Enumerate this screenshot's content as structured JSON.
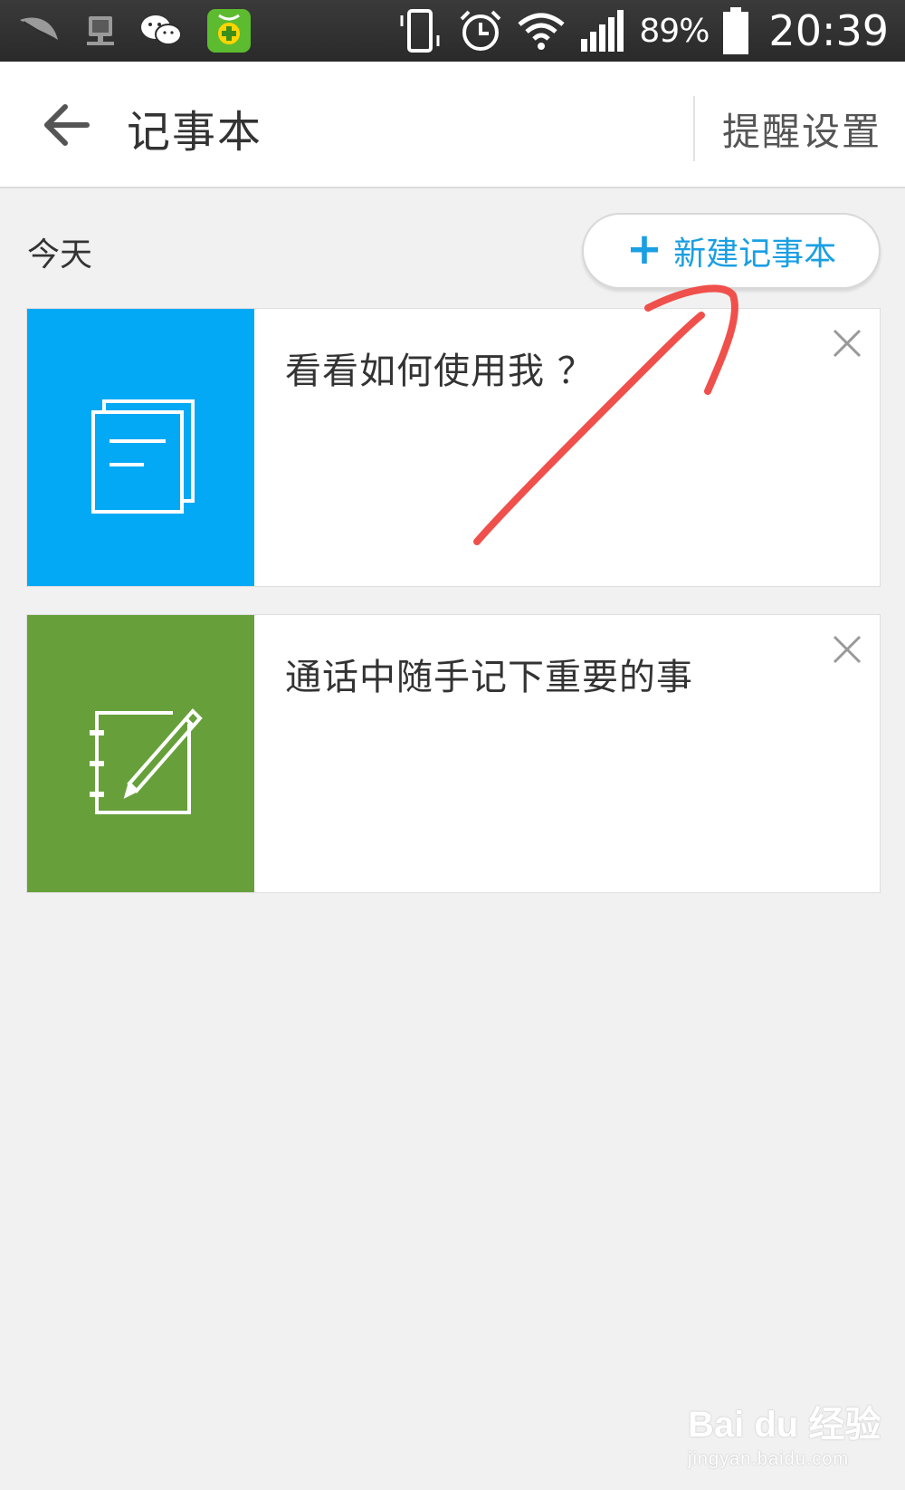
{
  "status_bar": {
    "battery_percent": "89%",
    "time": "20:39",
    "icons": [
      "feather-icon",
      "network-computer-icon",
      "wechat-icon",
      "security-app-icon",
      "vibrate-icon",
      "alarm-icon",
      "wifi-icon",
      "signal-icon",
      "battery-icon"
    ]
  },
  "header": {
    "title": "记事本",
    "back_icon": "arrow-left-icon",
    "remind_settings_label": "提醒设置"
  },
  "section": {
    "label": "今天",
    "new_button_label": "新建记事本"
  },
  "notes": [
    {
      "title": "看看如何使用我 ？",
      "thumb_color": "#03a9f4",
      "icon": "documents-icon"
    },
    {
      "title": "通话中随手记下重要的事",
      "thumb_color": "#67a03a",
      "icon": "notebook-pen-icon"
    }
  ],
  "colors": {
    "accent": "#1a9fe3",
    "annotation": "#f0504b"
  },
  "watermark": {
    "main": "Bai du 经验",
    "sub": "jingyan.baidu.com"
  }
}
